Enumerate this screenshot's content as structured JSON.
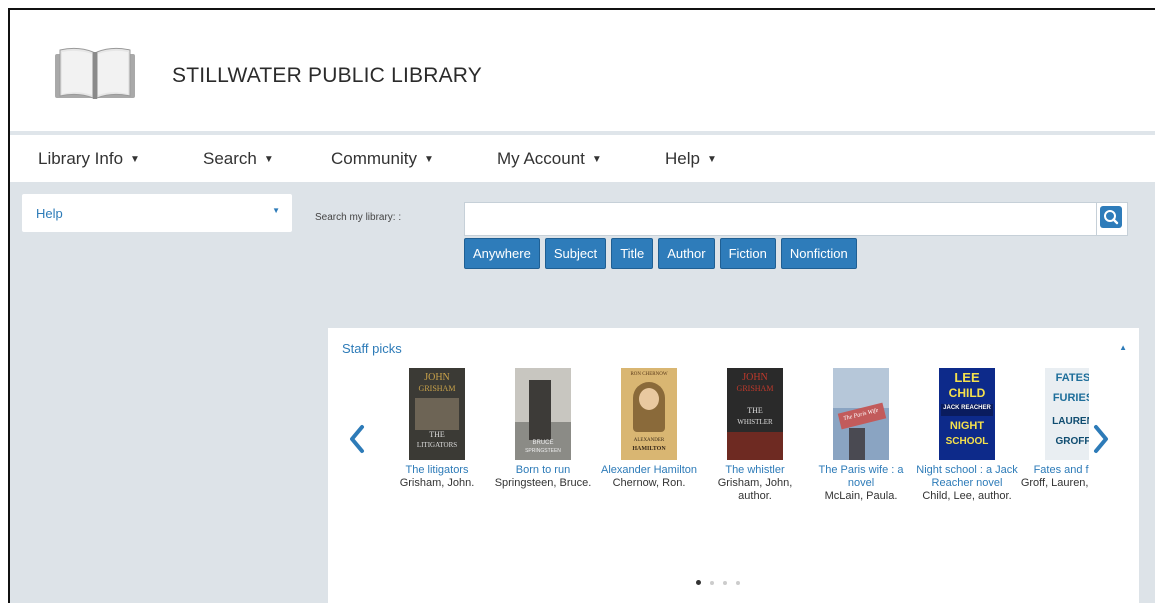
{
  "header": {
    "title": "STILLWATER PUBLIC LIBRARY",
    "logo_icon": "open-book-icon"
  },
  "nav": [
    {
      "label": "Library Info"
    },
    {
      "label": "Search"
    },
    {
      "label": "Community"
    },
    {
      "label": "My Account"
    },
    {
      "label": "Help"
    }
  ],
  "sidebar": {
    "selected": "Help"
  },
  "search": {
    "label": "Search my library: :",
    "value": "",
    "button_icon": "search-icon",
    "filters": [
      "Anywhere",
      "Subject",
      "Title",
      "Author",
      "Fiction",
      "Nonfiction"
    ]
  },
  "staff_picks": {
    "title": "Staff picks",
    "carousel_page": 1,
    "carousel_pages": 4,
    "books": [
      {
        "title": "The litigators",
        "author": "Grisham, John.",
        "cover_text": [
          "JOHN",
          "GRISHAM",
          "THE",
          "LITIGATORS"
        ]
      },
      {
        "title": "Born to run",
        "author": "Springsteen, Bruce.",
        "cover_text": [
          "BRUCE",
          "SPRINGSTEEN"
        ]
      },
      {
        "title": "Alexander Hamilton",
        "author": "Chernow, Ron.",
        "cover_text": [
          "RON CHERNOW",
          "ALEXANDER",
          "HAMILTON"
        ]
      },
      {
        "title": "The whistler",
        "author": "Grisham, John, author.",
        "cover_text": [
          "JOHN",
          "GRISHAM",
          "THE",
          "WHISTLER"
        ]
      },
      {
        "title": "The Paris wife : a novel",
        "author": "McLain, Paula.",
        "cover_text": [
          "The Paris Wife"
        ]
      },
      {
        "title": "Night school : a Jack Reacher novel",
        "author": "Child, Lee, author.",
        "cover_text": [
          "LEE",
          "CHILD",
          "JACK REACHER",
          "NIGHT",
          "SCHOOL"
        ]
      },
      {
        "title": "Fates and furies",
        "author": "Groff, Lauren, author.",
        "cover_text": [
          "FATES",
          "FURIES",
          "LAUREN",
          "GROFF"
        ]
      }
    ]
  },
  "colors": {
    "accent": "#2e7cba",
    "link": "#2d7bb8",
    "content_bg": "#dde3e8"
  }
}
